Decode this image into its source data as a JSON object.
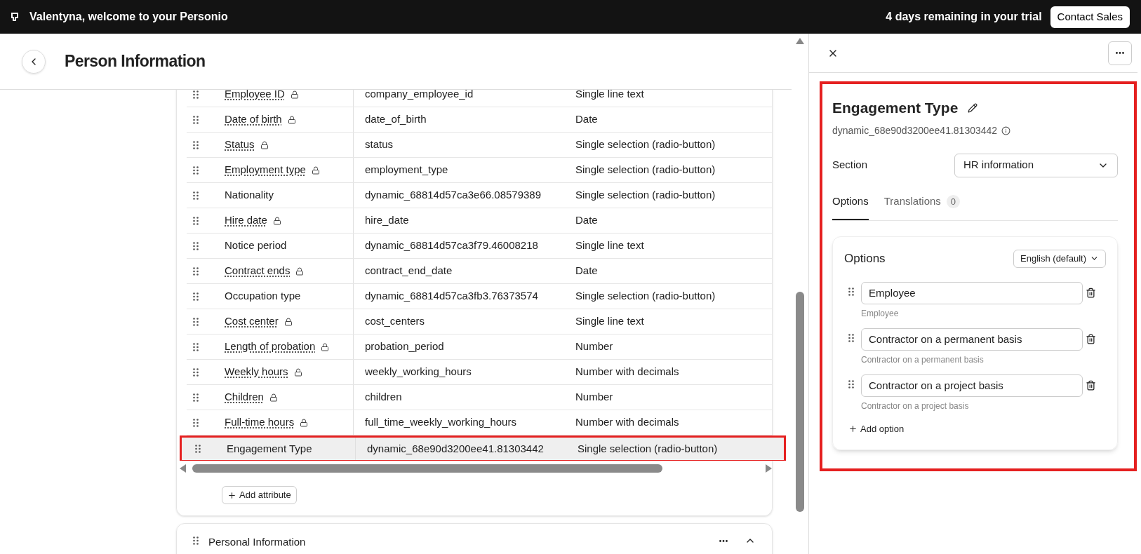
{
  "topbar": {
    "welcome": "Valentyna, welcome to your Personio",
    "trial": "4 days remaining in your trial",
    "contact_button": "Contact Sales"
  },
  "header": {
    "title": "Person Information"
  },
  "attributes": {
    "rows": [
      {
        "name": "Employee ID",
        "locked": true,
        "key": "company_employee_id",
        "type": "Single line text",
        "selected": false
      },
      {
        "name": "Date of birth",
        "locked": true,
        "key": "date_of_birth",
        "type": "Date",
        "selected": false
      },
      {
        "name": "Status",
        "locked": true,
        "key": "status",
        "type": "Single selection (radio-button)",
        "selected": false
      },
      {
        "name": "Employment type",
        "locked": true,
        "key": "employment_type",
        "type": "Single selection (radio-button)",
        "selected": false
      },
      {
        "name": "Nationality",
        "locked": false,
        "key": "dynamic_68814d57ca3e66.08579389",
        "type": "Single selection (radio-button)",
        "selected": false
      },
      {
        "name": "Hire date",
        "locked": true,
        "key": "hire_date",
        "type": "Date",
        "selected": false
      },
      {
        "name": "Notice period",
        "locked": false,
        "key": "dynamic_68814d57ca3f79.46008218",
        "type": "Single line text",
        "selected": false
      },
      {
        "name": "Contract ends",
        "locked": true,
        "key": "contract_end_date",
        "type": "Date",
        "selected": false
      },
      {
        "name": "Occupation type",
        "locked": false,
        "key": "dynamic_68814d57ca3fb3.76373574",
        "type": "Single selection (radio-button)",
        "selected": false
      },
      {
        "name": "Cost center",
        "locked": true,
        "key": "cost_centers",
        "type": "Single line text",
        "selected": false
      },
      {
        "name": "Length of probation",
        "locked": true,
        "key": "probation_period",
        "type": "Number",
        "selected": false
      },
      {
        "name": "Weekly hours",
        "locked": true,
        "key": "weekly_working_hours",
        "type": "Number with decimals",
        "selected": false
      },
      {
        "name": "Children",
        "locked": true,
        "key": "children",
        "type": "Number",
        "selected": false
      },
      {
        "name": "Full-time hours",
        "locked": true,
        "key": "full_time_weekly_working_hours",
        "type": "Number with decimals",
        "selected": false
      },
      {
        "name": "Engagement Type",
        "locked": false,
        "key": "dynamic_68e90d3200ee41.81303442",
        "type": "Single selection (radio-button)",
        "selected": true
      }
    ],
    "add_button": "Add attribute"
  },
  "section_card": {
    "title": "Personal Information",
    "expanded": true
  },
  "panel": {
    "title": "Engagement Type",
    "key": "dynamic_68e90d3200ee41.81303442",
    "section_label": "Section",
    "section_value": "HR information",
    "tabs": [
      {
        "label": "Options",
        "selected": true
      },
      {
        "label": "Translations",
        "badge": "0",
        "selected": false
      }
    ],
    "options_card": {
      "title": "Options",
      "language": "English (default)",
      "options": [
        {
          "value": "Employee",
          "helper": "Employee"
        },
        {
          "value": "Contractor on a permanent basis",
          "helper": "Contractor on a permanent basis"
        },
        {
          "value": "Contractor on a project basis",
          "helper": "Contractor on a project basis"
        }
      ],
      "add_button": "Add option"
    }
  }
}
